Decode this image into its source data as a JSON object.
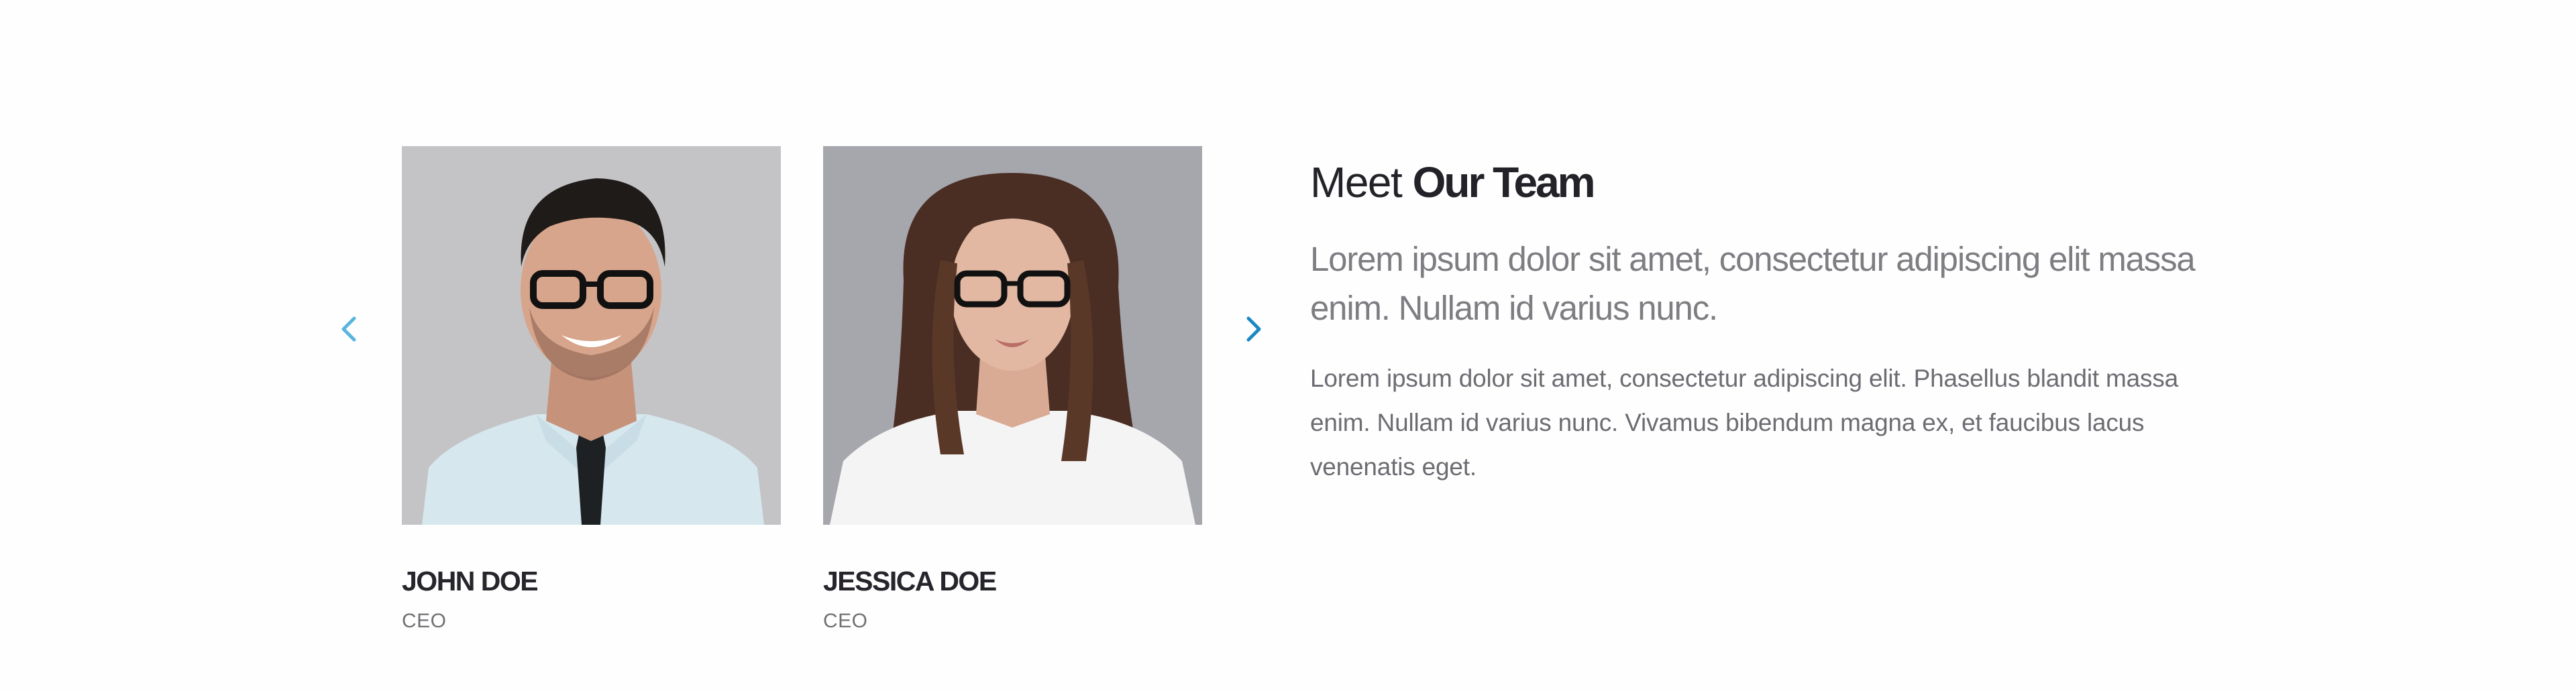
{
  "carousel": {
    "prev_icon": "chevron-left-icon",
    "next_icon": "chevron-right-icon",
    "prev_color": "#58b6dc",
    "next_color": "#1b88c4"
  },
  "team": [
    {
      "name": "JOHN DOE",
      "role": "CEO",
      "photo_icon": "portrait-man-with-glasses"
    },
    {
      "name": "JESSICA DOE",
      "role": "CEO",
      "photo_icon": "portrait-woman-with-glasses"
    }
  ],
  "intro": {
    "title_light": "Meet",
    "title_bold": "Our Team",
    "lead": "Lorem ipsum dolor sit amet, consectetur adipiscing elit massa enim. Nullam id varius nunc.",
    "body": "Lorem ipsum dolor sit amet, consectetur adipiscing elit. Phasellus blandit massa enim. Nullam id varius nunc. Vivamus bibendum magna ex, et faucibus lacus venenatis eget."
  },
  "colors": {
    "heading": "#222228",
    "muted": "#7d7d82",
    "accent": "#1b88c4"
  }
}
